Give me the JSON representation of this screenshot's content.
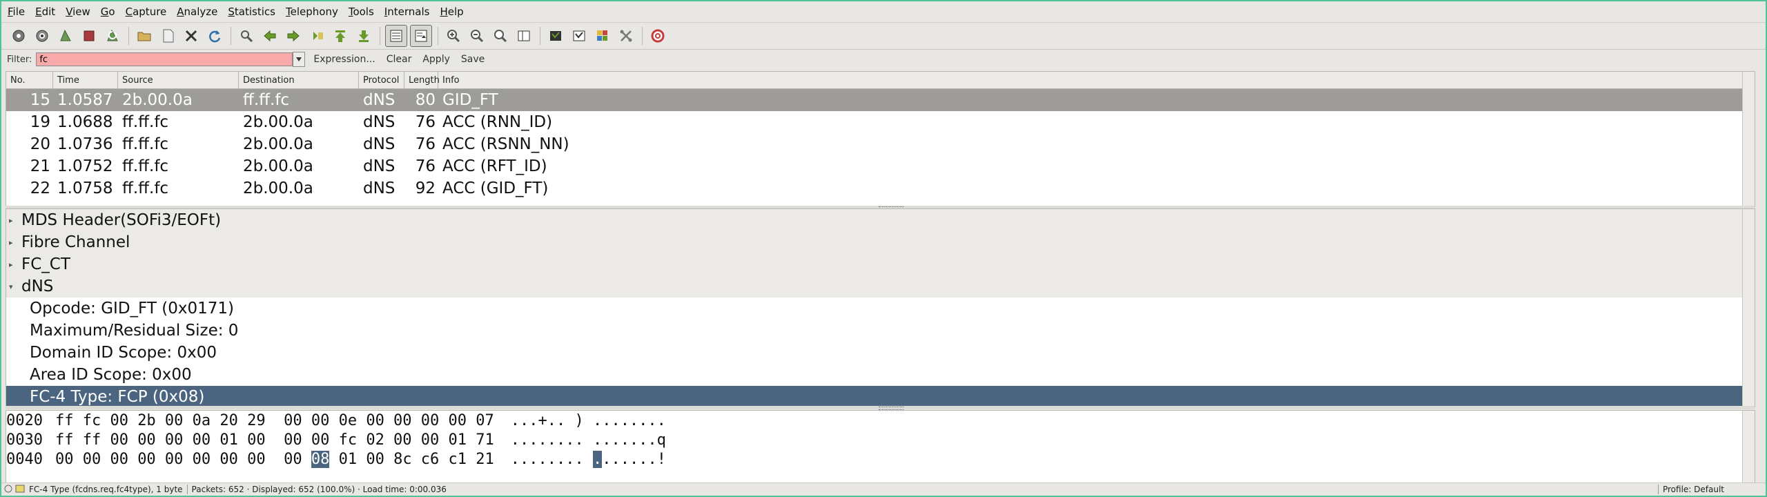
{
  "menu": [
    "File",
    "Edit",
    "View",
    "Go",
    "Capture",
    "Analyze",
    "Statistics",
    "Telephony",
    "Tools",
    "Internals",
    "Help"
  ],
  "toolbar": {
    "icons": [
      "interfaces-icon",
      "capture-options-icon",
      "start-capture-icon",
      "stop-capture-icon",
      "restart-capture-icon",
      "open-file-icon",
      "save-file-icon",
      "close-file-icon",
      "reload-icon",
      "find-packet-icon",
      "go-back-icon",
      "go-forward-icon",
      "go-to-packet-icon",
      "go-first-icon",
      "go-last-icon",
      "colorize-icon",
      "autoscroll-icon",
      "zoom-in-icon",
      "zoom-out-icon",
      "normal-size-icon",
      "resize-columns-icon",
      "capture-filters-icon",
      "display-filters-icon",
      "coloring-rules-icon",
      "preferences-icon",
      "help-icon"
    ]
  },
  "filter": {
    "label": "Filter:",
    "value": "fc",
    "expression": "Expression...",
    "clear": "Clear",
    "apply": "Apply",
    "save": "Save"
  },
  "packet_list": {
    "columns": [
      "No.",
      "Time",
      "Source",
      "Destination",
      "Protocol",
      "Length",
      "Info"
    ],
    "rows": [
      {
        "no": "15",
        "time": "1.0587",
        "src": "2b.00.0a",
        "dst": "ff.ff.fc",
        "proto": "dNS",
        "len": "80",
        "info": "GID_FT",
        "selected": true
      },
      {
        "no": "19",
        "time": "1.0688",
        "src": "ff.ff.fc",
        "dst": "2b.00.0a",
        "proto": "dNS",
        "len": "76",
        "info": "ACC (RNN_ID)",
        "selected": false
      },
      {
        "no": "20",
        "time": "1.0736",
        "src": "ff.ff.fc",
        "dst": "2b.00.0a",
        "proto": "dNS",
        "len": "76",
        "info": "ACC (RSNN_NN)",
        "selected": false
      },
      {
        "no": "21",
        "time": "1.0752",
        "src": "ff.ff.fc",
        "dst": "2b.00.0a",
        "proto": "dNS",
        "len": "76",
        "info": "ACC (RFT_ID)",
        "selected": false
      },
      {
        "no": "22",
        "time": "1.0758",
        "src": "ff.ff.fc",
        "dst": "2b.00.0a",
        "proto": "dNS",
        "len": "92",
        "info": "ACC (GID_FT)",
        "selected": false
      }
    ]
  },
  "details": [
    {
      "label": "MDS Header(SOFi3/EOFt)",
      "level": 0,
      "expanded": false,
      "selected": false
    },
    {
      "label": "Fibre Channel",
      "level": 0,
      "expanded": false,
      "selected": false
    },
    {
      "label": "FC_CT",
      "level": 0,
      "expanded": false,
      "selected": false
    },
    {
      "label": "dNS",
      "level": 0,
      "expanded": true,
      "selected": false
    },
    {
      "label": "Opcode: GID_FT (0x0171)",
      "level": 1,
      "selected": false
    },
    {
      "label": "Maximum/Residual Size: 0",
      "level": 1,
      "selected": false
    },
    {
      "label": "Domain ID Scope: 0x00",
      "level": 1,
      "selected": false
    },
    {
      "label": "Area ID Scope: 0x00",
      "level": 1,
      "selected": false
    },
    {
      "label": "FC-4 Type: FCP (0x08)",
      "level": 1,
      "selected": true
    }
  ],
  "bytes": [
    {
      "offset": "0020",
      "hex_a": "ff fc 00 2b 00 0a 20 29  00 00 0e 00 00 00 00 07",
      "hex_hl": "",
      "hex_b": "",
      "ascii_a": "...+.. ) ........",
      "ascii_hl": "",
      "ascii_b": ""
    },
    {
      "offset": "0030",
      "hex_a": "ff ff 00 00 00 00 01 00  00 00 fc 02 00 00 01 71",
      "hex_hl": "",
      "hex_b": "",
      "ascii_a": "........ .......q",
      "ascii_hl": "",
      "ascii_b": ""
    },
    {
      "offset": "0040",
      "hex_a": "00 00 00 00 00 00 00 00  00 ",
      "hex_hl": "08",
      "hex_b": " 01 00 8c c6 c1 21",
      "ascii_a": "........ ",
      "ascii_hl": ".",
      "ascii_b": "......!"
    }
  ],
  "status": {
    "field": "FC-4 Type (fcdns.req.fc4type), 1 byte",
    "packets": "Packets: 652 · Displayed: 652 (100.0%) · Load time: 0:00.036",
    "profile": "Profile: Default"
  }
}
